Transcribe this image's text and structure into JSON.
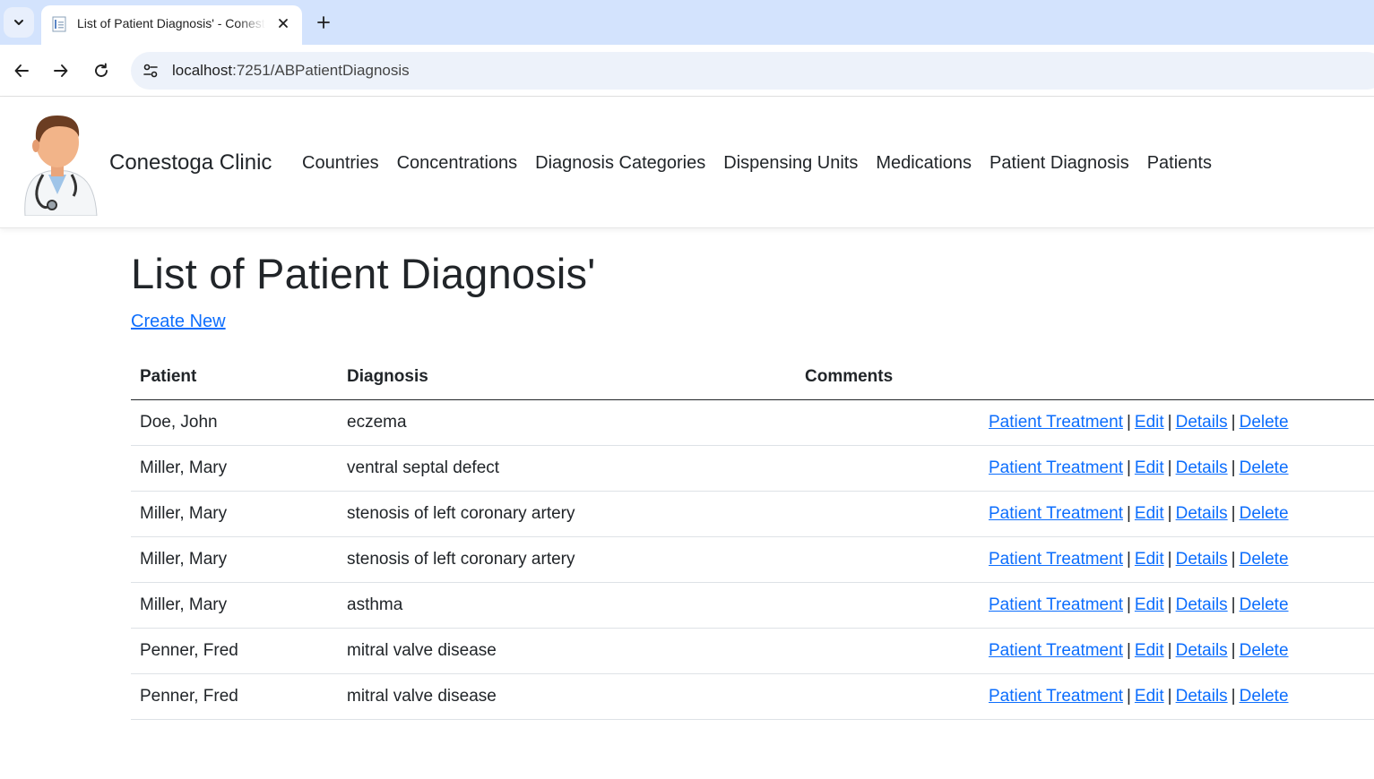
{
  "browser": {
    "tab_title": "List of Patient Diagnosis' - Conestoga Clinic",
    "url_host": "localhost",
    "url_path": ":7251/ABPatientDiagnosis"
  },
  "header": {
    "brand": "Conestoga Clinic",
    "menu": [
      {
        "label": "Countries"
      },
      {
        "label": "Concentrations"
      },
      {
        "label": "Diagnosis Categories"
      },
      {
        "label": "Dispensing Units"
      },
      {
        "label": "Medications"
      },
      {
        "label": "Patient Diagnosis"
      },
      {
        "label": "Patients"
      }
    ]
  },
  "main": {
    "title": "List of Patient Diagnosis'",
    "create_new": "Create New",
    "columns": {
      "patient": "Patient",
      "diagnosis": "Diagnosis",
      "comments": "Comments"
    },
    "actions": {
      "treatment": "Patient Treatment",
      "edit": "Edit",
      "details": "Details",
      "delete": "Delete",
      "separator": "|"
    },
    "rows": [
      {
        "patient": "Doe, John",
        "diagnosis": "eczema",
        "comments": ""
      },
      {
        "patient": "Miller, Mary",
        "diagnosis": "ventral septal defect",
        "comments": ""
      },
      {
        "patient": "Miller, Mary",
        "diagnosis": "stenosis of left coronary artery",
        "comments": ""
      },
      {
        "patient": "Miller, Mary",
        "diagnosis": "stenosis of left coronary artery",
        "comments": ""
      },
      {
        "patient": "Miller, Mary",
        "diagnosis": "asthma",
        "comments": ""
      },
      {
        "patient": "Penner, Fred",
        "diagnosis": "mitral valve disease",
        "comments": ""
      },
      {
        "patient": "Penner, Fred",
        "diagnosis": "mitral valve disease",
        "comments": ""
      }
    ]
  },
  "icons": {
    "tab_menu": "chevron-down-icon",
    "favicon": "document-icon",
    "tab_close": "close-icon",
    "new_tab": "plus-icon",
    "back": "arrow-left-icon",
    "forward": "arrow-right-icon",
    "reload": "reload-icon",
    "site_info": "tune-icon",
    "logo": "doctor-icon"
  },
  "colors": {
    "link": "#0d6efd",
    "text": "#212529",
    "tabbar": "#d3e3fd",
    "omnibox": "#edf2fa"
  }
}
